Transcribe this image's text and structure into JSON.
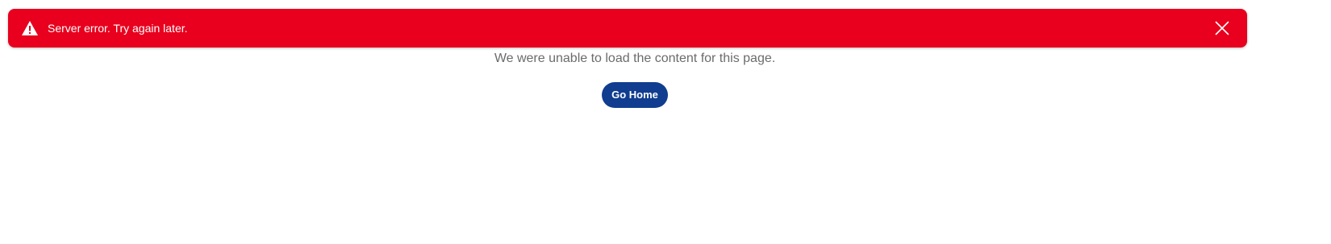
{
  "alert": {
    "icon": "warning-icon",
    "message": "Server error. Try again later.",
    "close_icon": "close-icon",
    "color": "#e8001e"
  },
  "main": {
    "message": "We were unable to load the content for this page.",
    "go_home_label": "Go Home",
    "button_color": "#103d8f"
  }
}
